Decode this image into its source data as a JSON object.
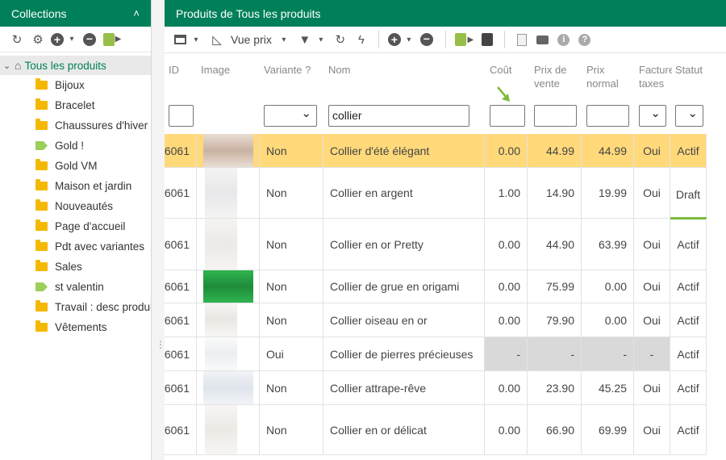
{
  "left_panel": {
    "title": "Collections",
    "root_label": "Tous les produits",
    "items": [
      {
        "label": "Bijoux",
        "icon": "folder-icon"
      },
      {
        "label": "Bracelet",
        "icon": "folder-icon"
      },
      {
        "label": "Chaussures d'hiver",
        "icon": "folder-icon"
      },
      {
        "label": "Gold !",
        "icon": "tag-icon"
      },
      {
        "label": "Gold VM",
        "icon": "folder-icon"
      },
      {
        "label": "Maison et jardin",
        "icon": "folder-icon"
      },
      {
        "label": "Nouveautés",
        "icon": "folder-icon"
      },
      {
        "label": "Page d'accueil",
        "icon": "folder-icon"
      },
      {
        "label": "Pdt avec variantes",
        "icon": "folder-icon"
      },
      {
        "label": "Sales",
        "icon": "folder-icon"
      },
      {
        "label": "st valentin",
        "icon": "tag-icon"
      },
      {
        "label": "Travail : desc produit",
        "icon": "folder-icon"
      },
      {
        "label": "Vêtements",
        "icon": "folder-icon"
      }
    ]
  },
  "right_panel": {
    "title": "Produits de Tous les produits",
    "view_label": "Vue prix"
  },
  "columns": {
    "id": "ID",
    "image": "Image",
    "variante": "Variante ?",
    "nom": "Nom",
    "cout": "Coût",
    "prix_vente_1": "Prix de",
    "prix_vente_2": "vente",
    "prix_normal_1": "Prix",
    "prix_normal_2": "normal",
    "facture_1": "Facture",
    "facture_2": "taxes",
    "statut": "Statut"
  },
  "filters": {
    "nom_value": "collier"
  },
  "rows": [
    {
      "id": "6061",
      "variante": "Non",
      "nom": "Collier d'été élégant",
      "cout": "0.00",
      "prix_vente": "44.99",
      "prix_normal": "44.99",
      "taxes": "Oui",
      "statut": "Actif"
    },
    {
      "id": "6061",
      "variante": "Non",
      "nom": "Collier en argent",
      "cout": "1.00",
      "prix_vente": "14.90",
      "prix_normal": "19.99",
      "taxes": "Oui",
      "statut": "Draft"
    },
    {
      "id": "6061",
      "variante": "Non",
      "nom": "Collier en or Pretty",
      "cout": "0.00",
      "prix_vente": "44.90",
      "prix_normal": "63.99",
      "taxes": "Oui",
      "statut": "Actif"
    },
    {
      "id": "6061",
      "variante": "Non",
      "nom": "Collier de grue en origami",
      "cout": "0.00",
      "prix_vente": "75.99",
      "prix_normal": "0.00",
      "taxes": "Oui",
      "statut": "Actif"
    },
    {
      "id": "6061",
      "variante": "Non",
      "nom": "Collier oiseau en or",
      "cout": "0.00",
      "prix_vente": "79.90",
      "prix_normal": "0.00",
      "taxes": "Oui",
      "statut": "Actif"
    },
    {
      "id": "6061",
      "variante": "Oui",
      "nom": "Collier de pierres précieuses",
      "cout": "-",
      "prix_vente": "-",
      "prix_normal": "-",
      "taxes": "-",
      "statut": "Actif"
    },
    {
      "id": "6061",
      "variante": "Non",
      "nom": "Collier attrape-rêve",
      "cout": "0.00",
      "prix_vente": "23.90",
      "prix_normal": "45.25",
      "taxes": "Oui",
      "statut": "Actif"
    },
    {
      "id": "6061",
      "variante": "Non",
      "nom": "Collier en or délicat",
      "cout": "0.00",
      "prix_vente": "66.90",
      "prix_normal": "69.99",
      "taxes": "Oui",
      "statut": "Actif"
    }
  ],
  "colors": {
    "header_green": "#00805a",
    "highlight_row": "#ffd97a",
    "draft_bar": "#7dbb3c"
  }
}
